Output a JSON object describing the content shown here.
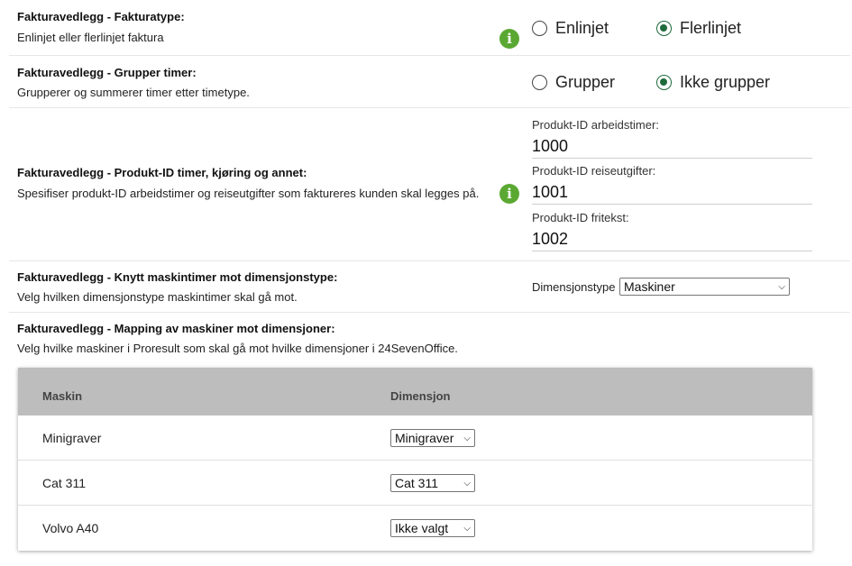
{
  "settings": [
    {
      "title": "Fakturavedlegg - Fakturatype:",
      "description": "Enlinjet eller flerlinjet faktura",
      "options": [
        {
          "label": "Enlinjet",
          "checked": false
        },
        {
          "label": "Flerlinjet",
          "checked": true
        }
      ]
    },
    {
      "title": "Fakturavedlegg - Grupper timer:",
      "description": "Grupperer og summerer timer etter timetype.",
      "options": [
        {
          "label": "Grupper",
          "checked": false
        },
        {
          "label": "Ikke grupper",
          "checked": true
        }
      ]
    },
    {
      "title": "Fakturavedlegg - Produkt-ID timer, kjøring og annet:",
      "description": "Spesifiser produkt-ID arbeidstimer og reiseutgifter som faktureres kunden skal legges på.",
      "fields": [
        {
          "label": "Produkt-ID arbeidstimer:",
          "value": "1000"
        },
        {
          "label": "Produkt-ID reiseutgifter:",
          "value": "1001"
        },
        {
          "label": "Produkt-ID fritekst:",
          "value": "1002"
        }
      ]
    },
    {
      "title": "Fakturavedlegg - Knytt maskintimer mot dimensjonstype:",
      "description": "Velg hvilken dimensjonstype maskintimer skal gå mot.",
      "select_label": "Dimensjonstype",
      "select_value": "Maskiner"
    },
    {
      "title": "Fakturavedlegg - Mapping av maskiner mot dimensjoner:",
      "description": "Velg hvilke maskiner i Proresult som skal gå mot hvilke dimensjoner i 24SevenOffice."
    }
  ],
  "info_icon_glyph": "i",
  "mapping_table": {
    "headers": [
      "Maskin",
      "Dimensjon"
    ],
    "rows": [
      {
        "machine": "Minigraver",
        "dimension": "Minigraver"
      },
      {
        "machine": "Cat 311",
        "dimension": "Cat 311"
      },
      {
        "machine": "Volvo A40",
        "dimension": "Ikke valgt"
      }
    ]
  },
  "colors": {
    "accent_green": "#5aa832",
    "radio_checked": "#1e6b3c",
    "table_header_bg": "#bdbdbd"
  }
}
